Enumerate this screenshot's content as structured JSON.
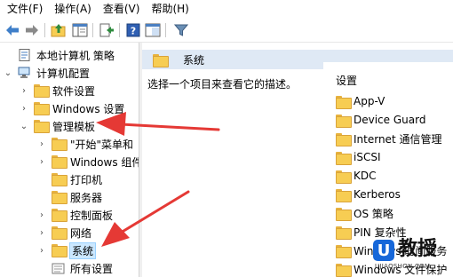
{
  "menu": {
    "items": [
      {
        "label": "文件(F)"
      },
      {
        "label": "操作(A)"
      },
      {
        "label": "查看(V)"
      },
      {
        "label": "帮助(H)"
      }
    ]
  },
  "toolbar": {
    "buttons": [
      {
        "icon": "back-arrow-icon"
      },
      {
        "icon": "forward-arrow-icon"
      },
      {
        "icon": "up-folder-icon"
      },
      {
        "icon": "show-hide-tree-icon"
      },
      {
        "icon": "export-list-icon"
      },
      {
        "icon": "help-icon"
      },
      {
        "icon": "properties-icon"
      },
      {
        "icon": "filter-icon"
      }
    ]
  },
  "tree": {
    "root": "本地计算机 策略",
    "computer_config": "计算机配置",
    "software_settings": "软件设置",
    "windows_settings": "Windows 设置",
    "admin_templates": "管理模板",
    "start_menu": "\"开始\"菜单和",
    "windows_components": "Windows 组件",
    "printers": "打印机",
    "servers": "服务器",
    "control_panel": "控制面板",
    "network": "网络",
    "system": "系统",
    "all_settings": "所有设置"
  },
  "right": {
    "header_title": "系统",
    "description": "选择一个项目来查看它的描述。",
    "column_header": "设置",
    "items": [
      {
        "label": "App-V"
      },
      {
        "label": "Device Guard"
      },
      {
        "label": "Internet 通信管理"
      },
      {
        "label": "iSCSI"
      },
      {
        "label": "KDC"
      },
      {
        "label": "Kerberos"
      },
      {
        "label": "OS 策略"
      },
      {
        "label": "PIN 复杂性"
      },
      {
        "label": "Windows 时间服务"
      },
      {
        "label": "Windows 文件保护"
      }
    ]
  },
  "watermark": {
    "badge": "U",
    "title": "教授",
    "subtitle": "UJIAOSHOU.COM"
  },
  "colors": {
    "selection": "#cce8ff",
    "header_band": "#dfe9f5",
    "folder": "#f7cd53",
    "annotation_arrow": "#e53935",
    "watermark_blue": "#1667d9"
  }
}
